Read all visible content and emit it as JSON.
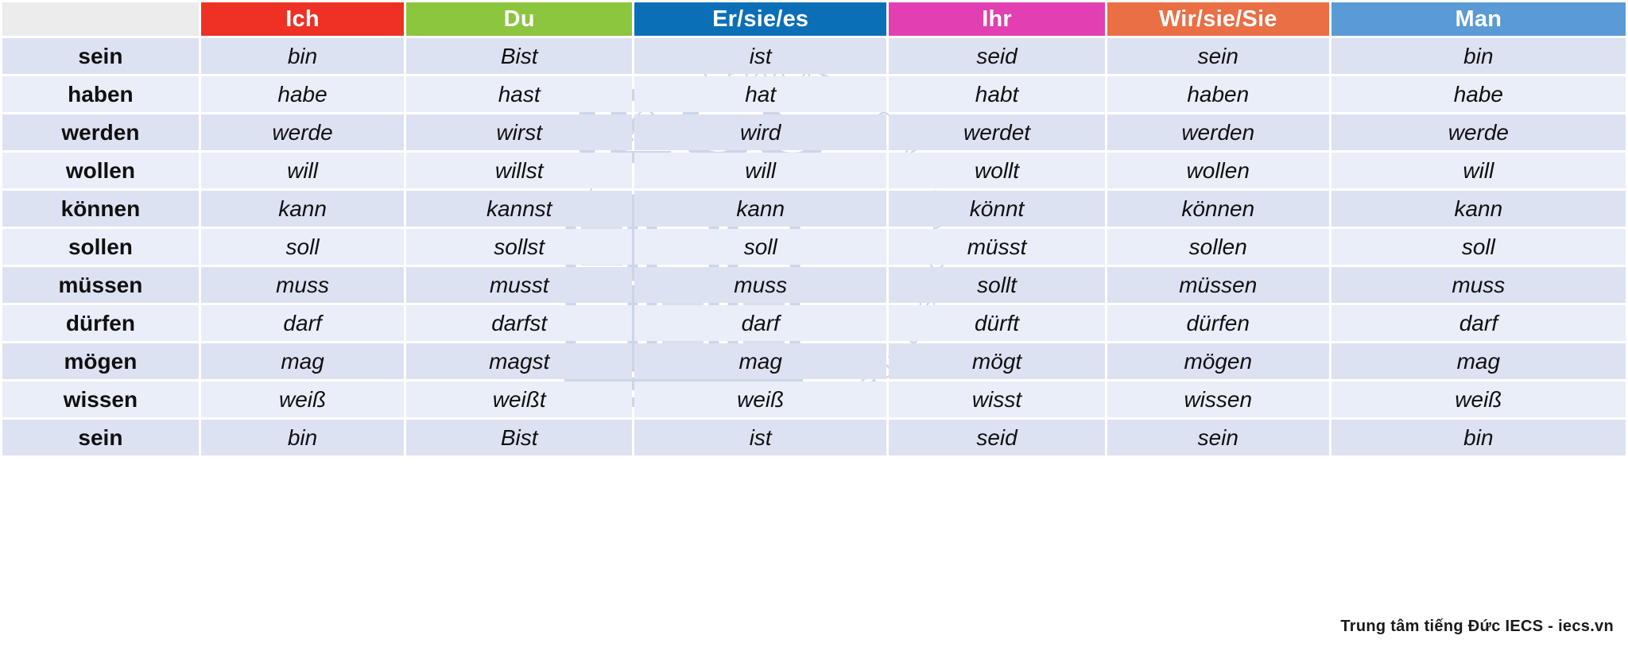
{
  "table": {
    "corner_label": "",
    "columns": [
      {
        "key": "verb",
        "label": "",
        "color": "#ececec"
      },
      {
        "key": "ich",
        "label": "Ich",
        "color": "#ee3124"
      },
      {
        "key": "du",
        "label": "Du",
        "color": "#8cc63e"
      },
      {
        "key": "er",
        "label": "Er/sie/es",
        "color": "#0b6fb8"
      },
      {
        "key": "ihr",
        "label": "Ihr",
        "color": "#e13fb2"
      },
      {
        "key": "wir",
        "label": "Wir/sie/Sie",
        "color": "#ea6f44"
      },
      {
        "key": "man",
        "label": "Man",
        "color": "#5b9bd5"
      }
    ],
    "rows": [
      {
        "verb": "sein",
        "ich": "bin",
        "du": "Bist",
        "er": "ist",
        "ihr": "seid",
        "wir": "sein",
        "man": "bin"
      },
      {
        "verb": "haben",
        "ich": "habe",
        "du": "hast",
        "er": "hat",
        "ihr": "habt",
        "wir": "haben",
        "man": "habe"
      },
      {
        "verb": "werden",
        "ich": "werde",
        "du": "wirst",
        "er": "wird",
        "ihr": "werdet",
        "wir": "werden",
        "man": "werde"
      },
      {
        "verb": "wollen",
        "ich": "will",
        "du": "willst",
        "er": "will",
        "ihr": "wollt",
        "wir": "wollen",
        "man": "will"
      },
      {
        "verb": "können",
        "ich": "kann",
        "du": "kannst",
        "er": "kann",
        "ihr": "könnt",
        "wir": "können",
        "man": "kann"
      },
      {
        "verb": "sollen",
        "ich": "soll",
        "du": "sollst",
        "er": "soll",
        "ihr": "müsst",
        "wir": "sollen",
        "man": "soll"
      },
      {
        "verb": "müssen",
        "ich": "muss",
        "du": "musst",
        "er": "muss",
        "ihr": "sollt",
        "wir": "müssen",
        "man": "muss"
      },
      {
        "verb": "dürfen",
        "ich": "darf",
        "du": "darfst",
        "er": "darf",
        "ihr": "dürft",
        "wir": "dürfen",
        "man": "darf"
      },
      {
        "verb": "mögen",
        "ich": "mag",
        "du": "magst",
        "er": "mag",
        "ihr": "mögt",
        "wir": "mögen",
        "man": "mag"
      },
      {
        "verb": "wissen",
        "ich": "weiß",
        "du": "weißt",
        "er": "weiß",
        "ihr": "wisst",
        "wir": "wissen",
        "man": "weiß"
      },
      {
        "verb": "sein",
        "ich": "bin",
        "du": "Bist",
        "er": "ist",
        "ihr": "seid",
        "wir": "sein",
        "man": "bin"
      }
    ],
    "row_colors": {
      "odd": "#dce2f1",
      "even": "#e9eef9"
    }
  },
  "watermark": {
    "logo_text": "IECS",
    "arc_text": "INTERNATIONAL EDUCATION CONSULTANCY SERVICES",
    "color": "#c9d3e6"
  },
  "footer": {
    "credit": "Trung tâm tiếng Đức IECS - iecs.vn"
  }
}
